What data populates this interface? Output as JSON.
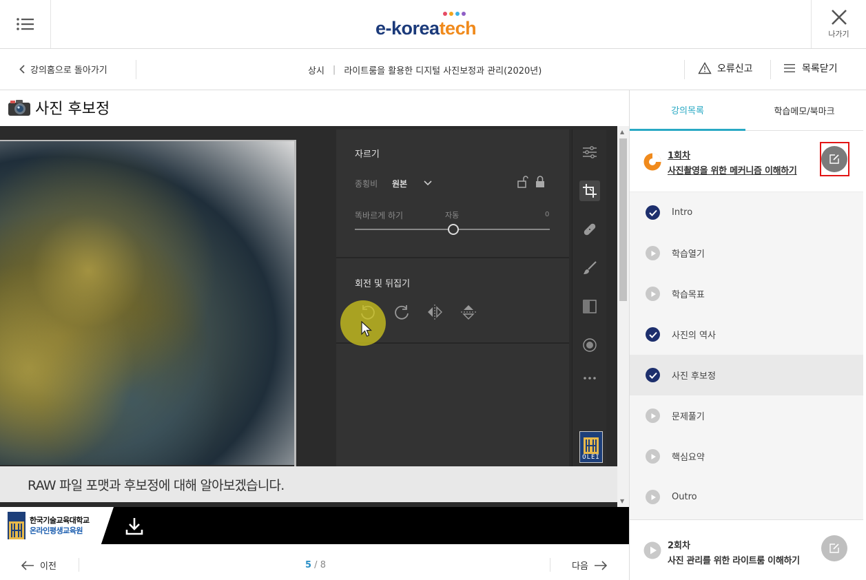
{
  "header": {
    "logo_part1": "e-korea",
    "logo_part2": "tech",
    "logo_dot_colors": [
      "#e64a64",
      "#f2a51d",
      "#3db2e6",
      "#8f5fc6"
    ],
    "exit_label": "나가기"
  },
  "subheader": {
    "back_label": "강의홈으로 돌아가기",
    "category": "상시",
    "divider": "|",
    "course_title": "라이트룸을 활용한 디지털 사진보정과 관리(2020년)",
    "report_label": "오류신고",
    "close_list_label": "목록닫기"
  },
  "page": {
    "heading": "사진 후보정"
  },
  "video": {
    "lr_panel": {
      "crop_title": "자르기",
      "aspect_label": "종횡비",
      "aspect_value": "원본",
      "straighten_label": "똑바르게 하기",
      "auto_label": "자동",
      "straighten_value": "0",
      "rotate_title": "회전 및 뒤집기"
    },
    "badge_text": "OLEI",
    "caption": "RAW 파일 포맷과 후보정에 대해 알아보겠습니다."
  },
  "player": {
    "org_line1": "한국기술교육대학교",
    "org_line2": "온라인평생교육원",
    "badge_text": "OLEI"
  },
  "pager": {
    "prev_label": "이전",
    "next_label": "다음",
    "current_page": "5",
    "separator": " / ",
    "total_pages": "8"
  },
  "sidebar": {
    "tabs": [
      {
        "label": "강의목록",
        "active": true
      },
      {
        "label": "학습메모/북마크",
        "active": false
      }
    ],
    "lesson1": {
      "number": "1회차",
      "title": "사진촬영을 위한 메커니즘 이해하기"
    },
    "chapters": [
      {
        "label": "Intro",
        "status": "done"
      },
      {
        "label": "학습열기",
        "status": "todo"
      },
      {
        "label": "학습목표",
        "status": "todo"
      },
      {
        "label": "사진의 역사",
        "status": "done"
      },
      {
        "label": "사진 후보정",
        "status": "done",
        "current": true
      },
      {
        "label": "문제풀기",
        "status": "todo"
      },
      {
        "label": "핵심요약",
        "status": "todo"
      },
      {
        "label": "Outro",
        "status": "todo"
      }
    ],
    "lesson2": {
      "number": "2회차",
      "title": "사진 관리를 위한 라이트룸 이해하기"
    }
  },
  "colors": {
    "accent_tab": "#29a9c4",
    "done_icon": "#1d2f6d",
    "highlight_border": "#e21414",
    "page_current": "#2a8fc6"
  }
}
